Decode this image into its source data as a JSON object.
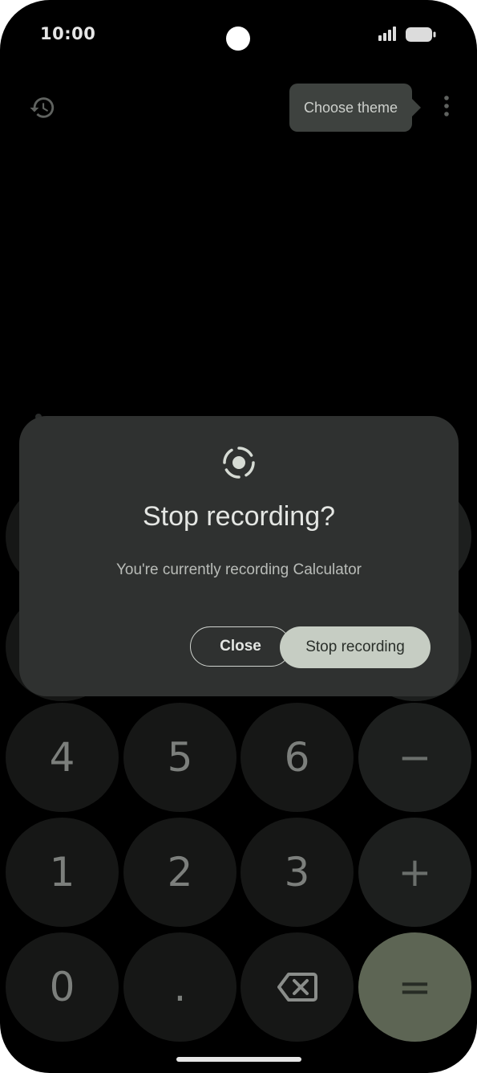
{
  "status_bar": {
    "time": "10:00"
  },
  "toolbar": {
    "history_icon": "history-icon",
    "tooltip_text": "Choose theme",
    "overflow_icon": "more-vert-icon"
  },
  "keypad": {
    "row_4": [
      "4",
      "5",
      "6",
      "−"
    ],
    "row_5": [
      "1",
      "2",
      "3",
      "+"
    ],
    "row_6": [
      "0",
      ".",
      "backspace-icon",
      "="
    ]
  },
  "dialog": {
    "icon": "screen-record-icon",
    "title": "Stop recording?",
    "body": "You're currently recording Calculator",
    "close_label": "Close",
    "stop_label": "Stop recording"
  },
  "colors": {
    "background": "#000000",
    "dialog_surface": "#2f3130",
    "primary_button": "#c6cdc3",
    "equals_key": "#5d6554"
  }
}
